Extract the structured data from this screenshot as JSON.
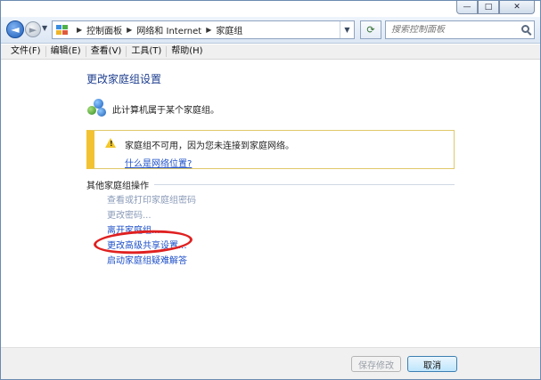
{
  "window": {
    "caption": {
      "minimize": "—",
      "maximize": "□",
      "close": "✕"
    }
  },
  "nav": {
    "back_glyph": "◄",
    "forward_glyph": "►",
    "breadcrumbs": [
      "控制面板",
      "网络和 Internet",
      "家庭组"
    ],
    "search_placeholder": "搜索控制面板"
  },
  "menu": {
    "items": [
      "文件(F)",
      "编辑(E)",
      "查看(V)",
      "工具(T)",
      "帮助(H)"
    ]
  },
  "main": {
    "title": "更改家庭组设置",
    "status_text": "此计算机属于某个家庭组。",
    "warning": {
      "text": "家庭组不可用，因为您未连接到家庭网络。",
      "link": "什么是网络位置?"
    },
    "other_actions": {
      "heading": "其他家庭组操作",
      "items": [
        {
          "label": "查看或打印家庭组密码",
          "state": "disabled"
        },
        {
          "label": "更改密码...",
          "state": "disabled"
        },
        {
          "label": "离开家庭组...",
          "state": "link"
        },
        {
          "label": "更改高级共享设置...",
          "state": "link"
        },
        {
          "label": "启动家庭组疑难解答",
          "state": "link"
        }
      ]
    }
  },
  "footer": {
    "save_label": "保存修改",
    "cancel_label": "取消"
  },
  "colors": {
    "link": "#1e50c8",
    "disabled": "#8a9bb8",
    "title": "#1f3f8f",
    "warning_accent": "#f2c232",
    "highlight": "#e02020"
  },
  "icons": [
    "back-arrow-icon",
    "forward-arrow-icon",
    "control-panel-icon",
    "refresh-icon",
    "search-icon",
    "homegroup-icon",
    "warning-icon"
  ]
}
